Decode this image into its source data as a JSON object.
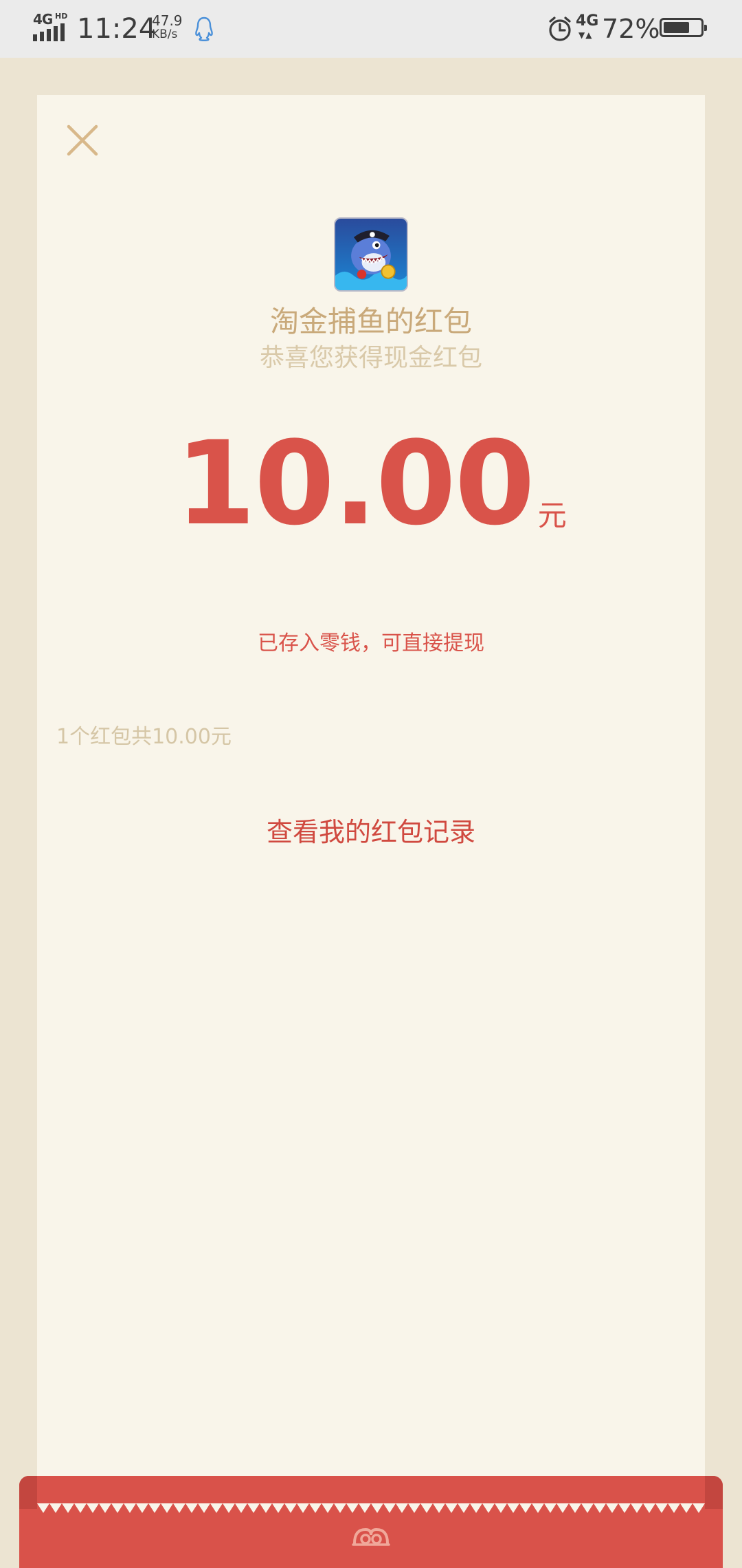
{
  "status_bar": {
    "network": "4G",
    "hd": "HD",
    "time": "11:24",
    "speed_value": "47.9",
    "speed_unit": "KB/s",
    "mobile_data": "4G",
    "battery_percent": "72%",
    "battery_level": 0.72,
    "icons": [
      "signal-icon",
      "qq-icon",
      "alarm-icon",
      "battery-icon"
    ]
  },
  "red_packet": {
    "close_icon": "close-icon",
    "sender_title": "淘金捕鱼的红包",
    "greeting": "恭喜您获得现金红包",
    "amount": "10.00",
    "unit": "元",
    "deposited_note": "已存入零钱，可直接提现",
    "summary": "1个红包共10.00元",
    "records_link": "查看我的红包记录"
  },
  "colors": {
    "accent_red": "#d9534a",
    "gold_text": "#c9a97a",
    "card_bg": "#f9f5ea",
    "page_bg": "#ece4d2"
  }
}
